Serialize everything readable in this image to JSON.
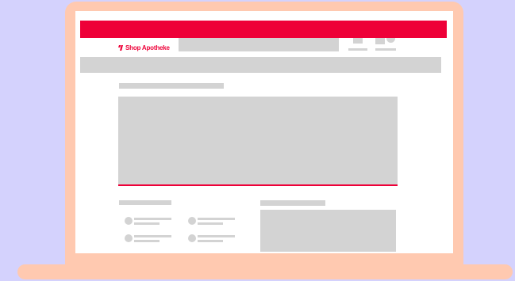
{
  "theme": {
    "background": "#d4d2fd",
    "laptop": "#ffc9b0",
    "accent": "#ee0038",
    "placeholder": "#d3d3d3",
    "screen": "#ffffff"
  },
  "header": {
    "brand": "Shop Apotheke",
    "logo_icon": "shop-apotheke-logo-icon",
    "account_icon": "account-icon",
    "cart_icon": "cart-icon"
  }
}
